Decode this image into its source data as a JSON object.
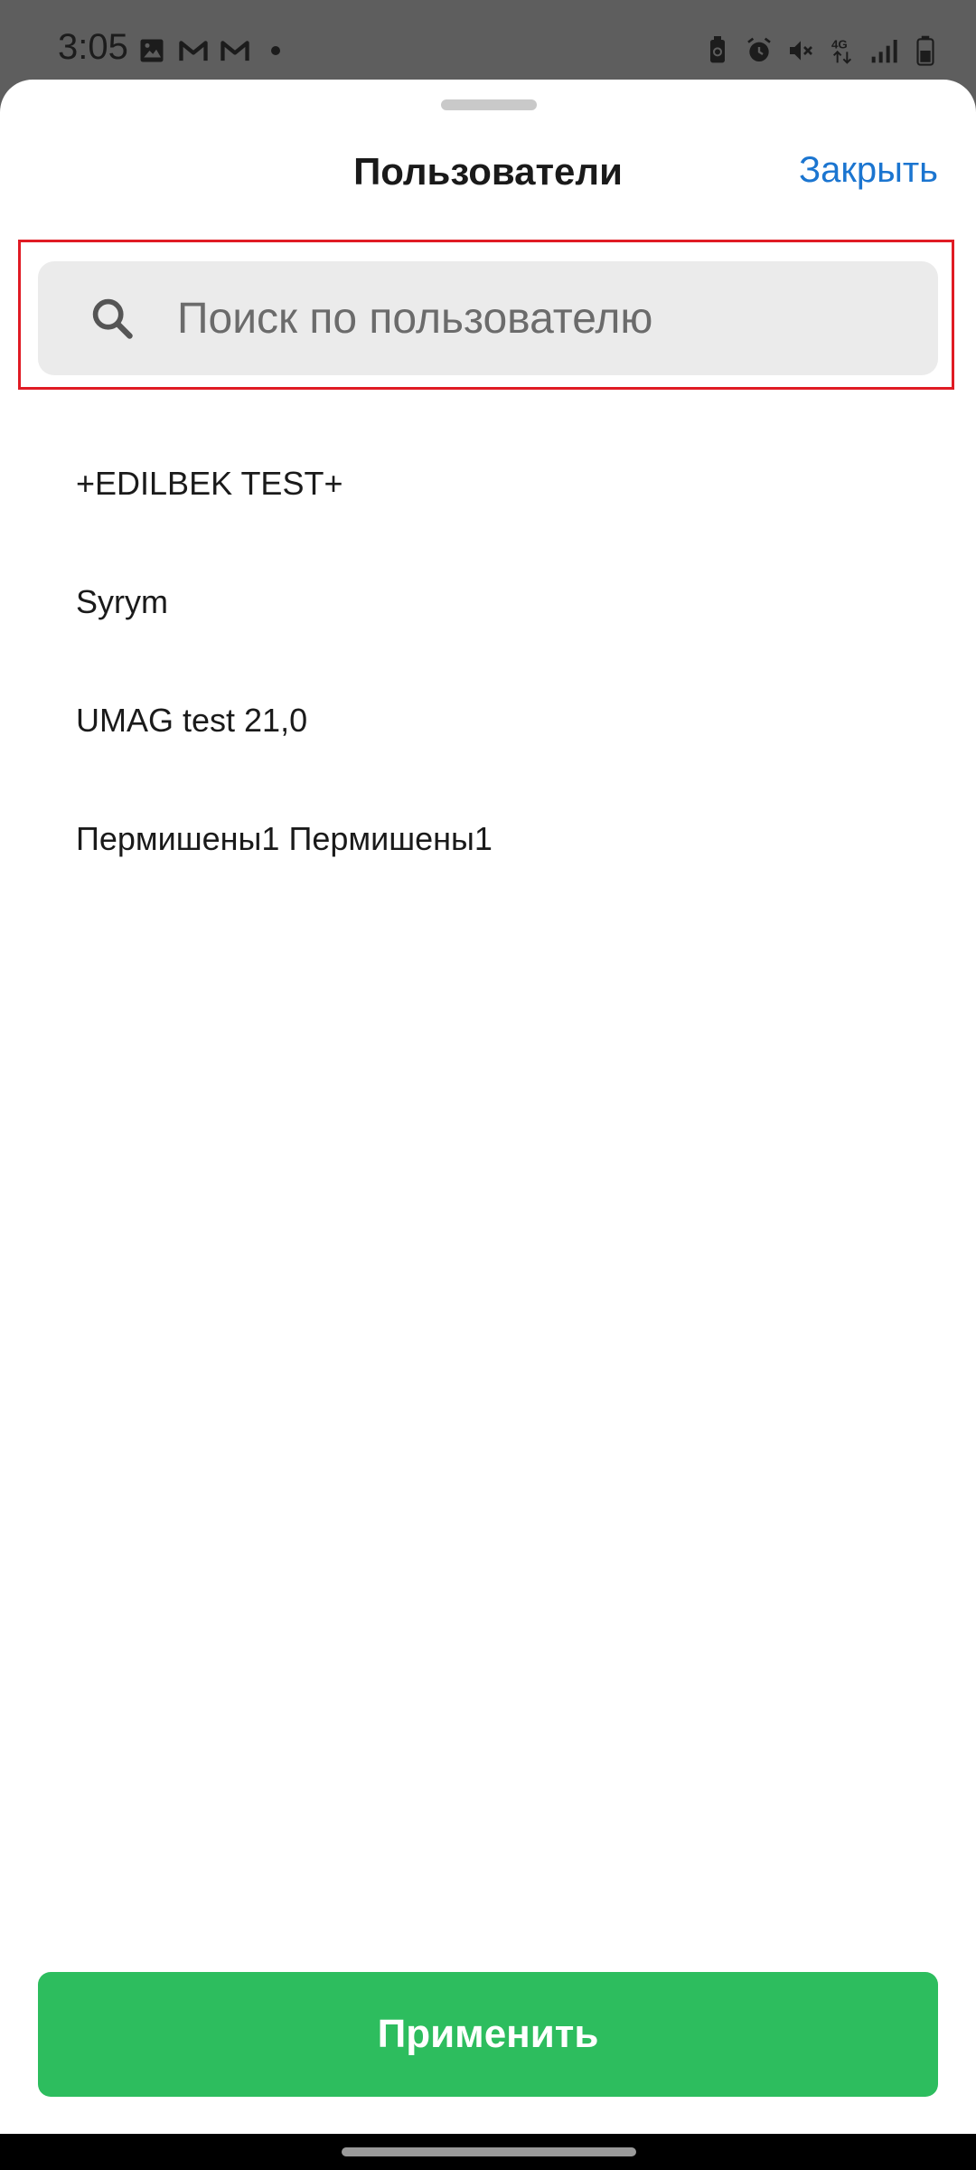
{
  "status_bar": {
    "time": "3:05",
    "left_icons": [
      "image-icon",
      "gmail-icon",
      "gmail-icon"
    ],
    "right_icons": [
      "battery-saver-icon",
      "alarm-icon",
      "vibrate-off-icon",
      "4g-icon",
      "signal-icon",
      "battery-icon"
    ]
  },
  "sheet": {
    "title": "Пользователи",
    "close_label": "Закрыть"
  },
  "search": {
    "placeholder": "Поиск по пользователю",
    "value": ""
  },
  "users": [
    {
      "name": "+EDILBEK TEST+"
    },
    {
      "name": "Syrym"
    },
    {
      "name": "UMAG test 21,0"
    },
    {
      "name": "Пермишены1 Пермишены1"
    }
  ],
  "apply_label": "Применить",
  "colors": {
    "accent_link": "#1b75d0",
    "apply_button": "#2dbd5e",
    "highlight_border": "#e01b24",
    "search_bg": "#ebebeb"
  }
}
